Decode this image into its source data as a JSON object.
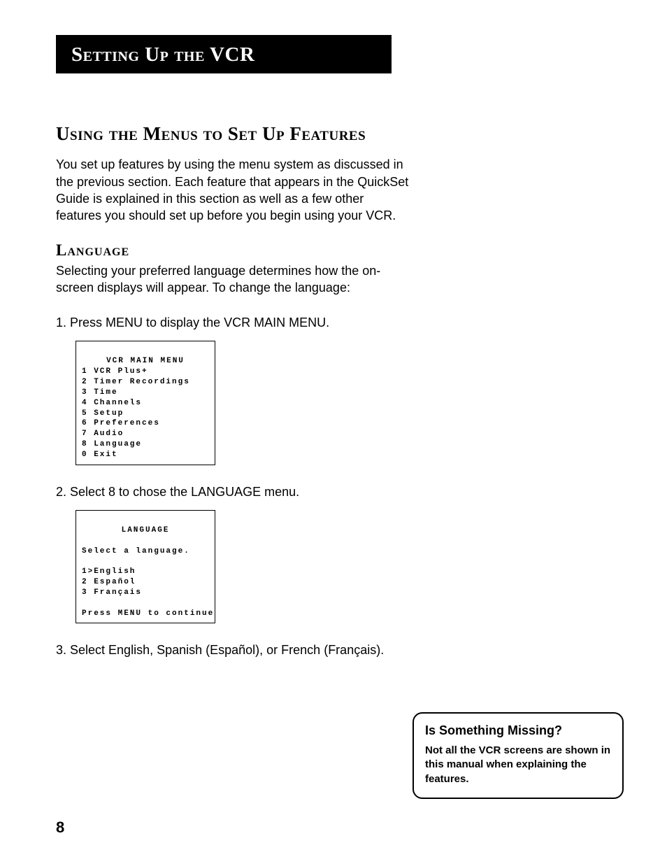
{
  "chapter_title": "Setting Up the VCR",
  "section_title": "Using the Menus to Set Up Features",
  "intro_para": "You set up features by using the menu system as discussed in the previous section. Each feature that appears in the QuickSet Guide is explained in this section as well as a few other features you should set up before you begin using your VCR.",
  "subsection_title": "Language",
  "subsection_para": "Selecting your preferred language determines how the on-screen displays will appear. To change the language:",
  "steps": [
    "1.  Press MENU to display the VCR MAIN MENU.",
    "2.  Select 8 to chose the LANGUAGE menu.",
    "3.  Select English, Spanish (Español), or French (Français)."
  ],
  "screen1": {
    "title": "VCR MAIN MENU",
    "lines": [
      "1 VCR Plus+",
      "2 Timer Recordings",
      "3 Time",
      "4 Channels",
      "5 Setup",
      "6 Preferences",
      "7 Audio",
      "8 Language",
      "0 Exit"
    ]
  },
  "screen2": {
    "title": "LANGUAGE",
    "prompt": "Select a language.",
    "options": [
      "1>English",
      "2 Español",
      "3 Français"
    ],
    "footer": "Press MENU to continue"
  },
  "callout": {
    "title": "Is Something Missing?",
    "body": "Not all the VCR screens are shown in this manual when explaining the features."
  },
  "page_number": "8"
}
